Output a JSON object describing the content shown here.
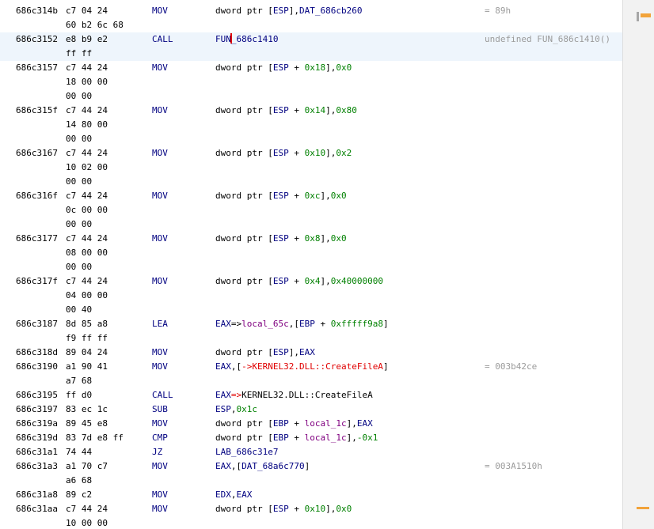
{
  "listing": [
    {
      "addr": "686c314b",
      "bytes": [
        "c7 04 24",
        "60 b2 6c 68"
      ],
      "mnemonic": "MOV",
      "operands": [
        {
          "t": "dword ptr [",
          "k": "p"
        },
        {
          "t": "ESP",
          "k": "r"
        },
        {
          "t": "],",
          "k": "p"
        },
        {
          "t": "DAT_686cb260",
          "k": "r"
        }
      ],
      "comment": "= 89h"
    },
    {
      "addr": "686c3152",
      "bytes": [
        "e8 b9 e2",
        "ff ff"
      ],
      "mnemonic": "CALL",
      "operands": [
        {
          "t": "FUN",
          "k": "r"
        },
        {
          "t": "",
          "k": "caret"
        },
        {
          "t": "_686c1410",
          "k": "r"
        }
      ],
      "comment": "undefined FUN_686c1410()",
      "selected": true
    },
    {
      "addr": "686c3157",
      "bytes": [
        "c7 44 24",
        "18 00 00",
        "00 00"
      ],
      "mnemonic": "MOV",
      "operands": [
        {
          "t": "dword ptr [",
          "k": "p"
        },
        {
          "t": "ESP",
          "k": "r"
        },
        {
          "t": " + ",
          "k": "p"
        },
        {
          "t": "0x18",
          "k": "c"
        },
        {
          "t": "],",
          "k": "p"
        },
        {
          "t": "0x0",
          "k": "c"
        }
      ],
      "comment": ""
    },
    {
      "addr": "686c315f",
      "bytes": [
        "c7 44 24",
        "14 80 00",
        "00 00"
      ],
      "mnemonic": "MOV",
      "operands": [
        {
          "t": "dword ptr [",
          "k": "p"
        },
        {
          "t": "ESP",
          "k": "r"
        },
        {
          "t": " + ",
          "k": "p"
        },
        {
          "t": "0x14",
          "k": "c"
        },
        {
          "t": "],",
          "k": "p"
        },
        {
          "t": "0x80",
          "k": "c"
        }
      ],
      "comment": ""
    },
    {
      "addr": "686c3167",
      "bytes": [
        "c7 44 24",
        "10 02 00",
        "00 00"
      ],
      "mnemonic": "MOV",
      "operands": [
        {
          "t": "dword ptr [",
          "k": "p"
        },
        {
          "t": "ESP",
          "k": "r"
        },
        {
          "t": " + ",
          "k": "p"
        },
        {
          "t": "0x10",
          "k": "c"
        },
        {
          "t": "],",
          "k": "p"
        },
        {
          "t": "0x2",
          "k": "c"
        }
      ],
      "comment": ""
    },
    {
      "addr": "686c316f",
      "bytes": [
        "c7 44 24",
        "0c 00 00",
        "00 00"
      ],
      "mnemonic": "MOV",
      "operands": [
        {
          "t": "dword ptr [",
          "k": "p"
        },
        {
          "t": "ESP",
          "k": "r"
        },
        {
          "t": " + ",
          "k": "p"
        },
        {
          "t": "0xc",
          "k": "c"
        },
        {
          "t": "],",
          "k": "p"
        },
        {
          "t": "0x0",
          "k": "c"
        }
      ],
      "comment": ""
    },
    {
      "addr": "686c3177",
      "bytes": [
        "c7 44 24",
        "08 00 00",
        "00 00"
      ],
      "mnemonic": "MOV",
      "operands": [
        {
          "t": "dword ptr [",
          "k": "p"
        },
        {
          "t": "ESP",
          "k": "r"
        },
        {
          "t": " + ",
          "k": "p"
        },
        {
          "t": "0x8",
          "k": "c"
        },
        {
          "t": "],",
          "k": "p"
        },
        {
          "t": "0x0",
          "k": "c"
        }
      ],
      "comment": ""
    },
    {
      "addr": "686c317f",
      "bytes": [
        "c7 44 24",
        "04 00 00",
        "00 40"
      ],
      "mnemonic": "MOV",
      "operands": [
        {
          "t": "dword ptr [",
          "k": "p"
        },
        {
          "t": "ESP",
          "k": "r"
        },
        {
          "t": " + ",
          "k": "p"
        },
        {
          "t": "0x4",
          "k": "c"
        },
        {
          "t": "],",
          "k": "p"
        },
        {
          "t": "0x40000000",
          "k": "c"
        }
      ],
      "comment": ""
    },
    {
      "addr": "686c3187",
      "bytes": [
        "8d 85 a8",
        "f9 ff ff"
      ],
      "mnemonic": "LEA",
      "operands": [
        {
          "t": "EAX",
          "k": "r"
        },
        {
          "t": "=>",
          "k": "p"
        },
        {
          "t": "local_65c",
          "k": "l"
        },
        {
          "t": ",[",
          "k": "p"
        },
        {
          "t": "EBP",
          "k": "r"
        },
        {
          "t": " + ",
          "k": "p"
        },
        {
          "t": "0xfffff9a8",
          "k": "c"
        },
        {
          "t": "]",
          "k": "p"
        }
      ],
      "comment": ""
    },
    {
      "addr": "686c318d",
      "bytes": [
        "89 04 24"
      ],
      "mnemonic": "MOV",
      "operands": [
        {
          "t": "dword ptr [",
          "k": "p"
        },
        {
          "t": "ESP",
          "k": "r"
        },
        {
          "t": "],",
          "k": "p"
        },
        {
          "t": "EAX",
          "k": "r"
        }
      ],
      "comment": ""
    },
    {
      "addr": "686c3190",
      "bytes": [
        "a1 90 41",
        "a7 68"
      ],
      "mnemonic": "MOV",
      "operands": [
        {
          "t": "EAX",
          "k": "r"
        },
        {
          "t": ",[",
          "k": "p"
        },
        {
          "t": "->KERNEL32.DLL::CreateFileA",
          "k": "x"
        },
        {
          "t": "]",
          "k": "p"
        }
      ],
      "comment": "= 003b42ce"
    },
    {
      "addr": "686c3195",
      "bytes": [
        "ff d0"
      ],
      "mnemonic": "CALL",
      "operands": [
        {
          "t": "EAX",
          "k": "r"
        },
        {
          "t": "=>",
          "k": "x"
        },
        {
          "t": "KERNEL32.DLL::CreateFileA",
          "k": "p"
        }
      ],
      "comment": ""
    },
    {
      "addr": "686c3197",
      "bytes": [
        "83 ec 1c"
      ],
      "mnemonic": "SUB",
      "operands": [
        {
          "t": "ESP",
          "k": "r"
        },
        {
          "t": ",",
          "k": "p"
        },
        {
          "t": "0x1c",
          "k": "c"
        }
      ],
      "comment": ""
    },
    {
      "addr": "686c319a",
      "bytes": [
        "89 45 e8"
      ],
      "mnemonic": "MOV",
      "operands": [
        {
          "t": "dword ptr [",
          "k": "p"
        },
        {
          "t": "EBP",
          "k": "r"
        },
        {
          "t": " + ",
          "k": "p"
        },
        {
          "t": "local_1c",
          "k": "l"
        },
        {
          "t": "],",
          "k": "p"
        },
        {
          "t": "EAX",
          "k": "r"
        }
      ],
      "comment": ""
    },
    {
      "addr": "686c319d",
      "bytes": [
        "83 7d e8 ff"
      ],
      "mnemonic": "CMP",
      "operands": [
        {
          "t": "dword ptr [",
          "k": "p"
        },
        {
          "t": "EBP",
          "k": "r"
        },
        {
          "t": " + ",
          "k": "p"
        },
        {
          "t": "local_1c",
          "k": "l"
        },
        {
          "t": "],",
          "k": "p"
        },
        {
          "t": "-0x1",
          "k": "c"
        }
      ],
      "comment": ""
    },
    {
      "addr": "686c31a1",
      "bytes": [
        "74 44"
      ],
      "mnemonic": "JZ",
      "operands": [
        {
          "t": "LAB_686c31e7",
          "k": "r"
        }
      ],
      "comment": ""
    },
    {
      "addr": "686c31a3",
      "bytes": [
        "a1 70 c7",
        "a6 68"
      ],
      "mnemonic": "MOV",
      "operands": [
        {
          "t": "EAX",
          "k": "r"
        },
        {
          "t": ",[",
          "k": "p"
        },
        {
          "t": "DAT_68a6c770",
          "k": "r"
        },
        {
          "t": "]",
          "k": "p"
        }
      ],
      "comment": "= 003A1510h"
    },
    {
      "addr": "686c31a8",
      "bytes": [
        "89 c2"
      ],
      "mnemonic": "MOV",
      "operands": [
        {
          "t": "EDX",
          "k": "r"
        },
        {
          "t": ",",
          "k": "p"
        },
        {
          "t": "EAX",
          "k": "r"
        }
      ],
      "comment": ""
    },
    {
      "addr": "686c31aa",
      "bytes": [
        "c7 44 24",
        "10 00 00"
      ],
      "mnemonic": "MOV",
      "operands": [
        {
          "t": "dword ptr [",
          "k": "p"
        },
        {
          "t": "ESP",
          "k": "r"
        },
        {
          "t": " + ",
          "k": "p"
        },
        {
          "t": "0x10",
          "k": "c"
        },
        {
          "t": "],",
          "k": "p"
        },
        {
          "t": "0x0",
          "k": "c"
        }
      ],
      "comment": ""
    }
  ],
  "colors": {
    "register": "#000080",
    "constant": "#008000",
    "local": "#800080",
    "external": "#e00000",
    "comment": "#9b9b9b",
    "selection": "#eef5fc",
    "marker": "#f2a33a"
  }
}
